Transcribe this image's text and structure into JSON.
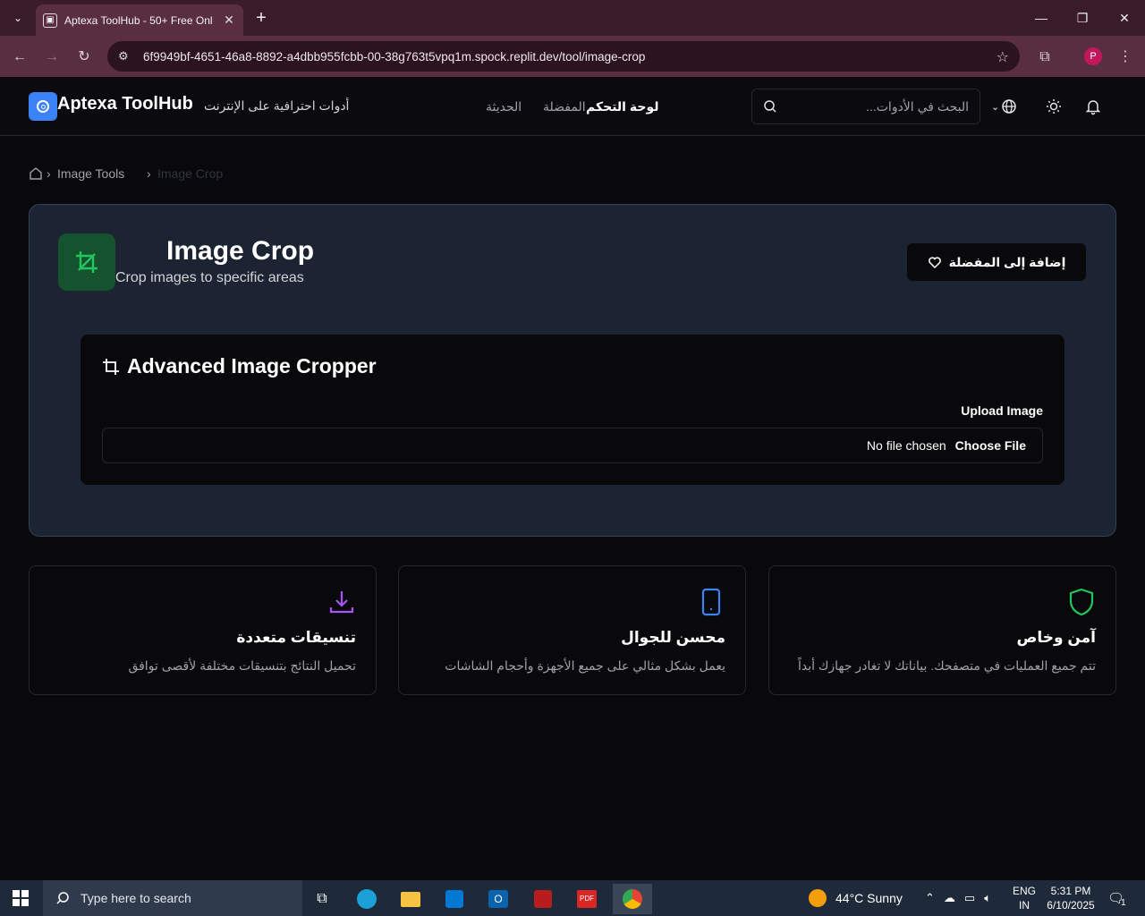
{
  "browser": {
    "tab_title": "Aptexa ToolHub - 50+ Free Onl",
    "url": "6f9949bf-4651-46a8-8892-a4dbb955fcbb-00-38g763t5vpq1m.spock.replit.dev/tool/image-crop",
    "profile_initial": "P"
  },
  "header": {
    "brand": "Aptexa ToolHub",
    "tagline": "أدوات احترافية على الإنترنت",
    "nav": {
      "dashboard": "لوحة التحكم",
      "favorites": "المفضلة",
      "recent": "الحديثة"
    },
    "search_placeholder": "البحث في الأدوات..."
  },
  "breadcrumb": {
    "category": "Image Tools",
    "current": "Image Crop"
  },
  "tool": {
    "title": "Image Crop",
    "description": "Crop images to specific areas",
    "favorite_button": "إضافة إلى المفضلة",
    "icon_color": "#22c55e"
  },
  "cropper": {
    "title": "Advanced Image Cropper",
    "upload_label": "Upload Image",
    "no_file": "No file chosen",
    "choose_file": "Choose File"
  },
  "features": [
    {
      "title": "تنسيقات متعددة",
      "description": "تحميل النتائج بتنسيقات مختلفة لأقصى توافق",
      "icon": "download-icon",
      "color": "#a855f7"
    },
    {
      "title": "محسن للجوال",
      "description": "يعمل بشكل مثالي على جميع الأجهزة وأحجام الشاشات",
      "icon": "tablet-icon",
      "color": "#3b82f6"
    },
    {
      "title": "آمن وخاص",
      "description": "تتم جميع العمليات في متصفحك. بياناتك لا تغادر جهازك أبداً",
      "icon": "shield-icon",
      "color": "#22c55e"
    }
  ],
  "taskbar": {
    "search_placeholder": "Type here to search",
    "weather": "44°C  Sunny",
    "lang": "ENG",
    "region": "IN",
    "time": "5:31 PM",
    "date": "6/10/2025",
    "notifications": "1"
  }
}
